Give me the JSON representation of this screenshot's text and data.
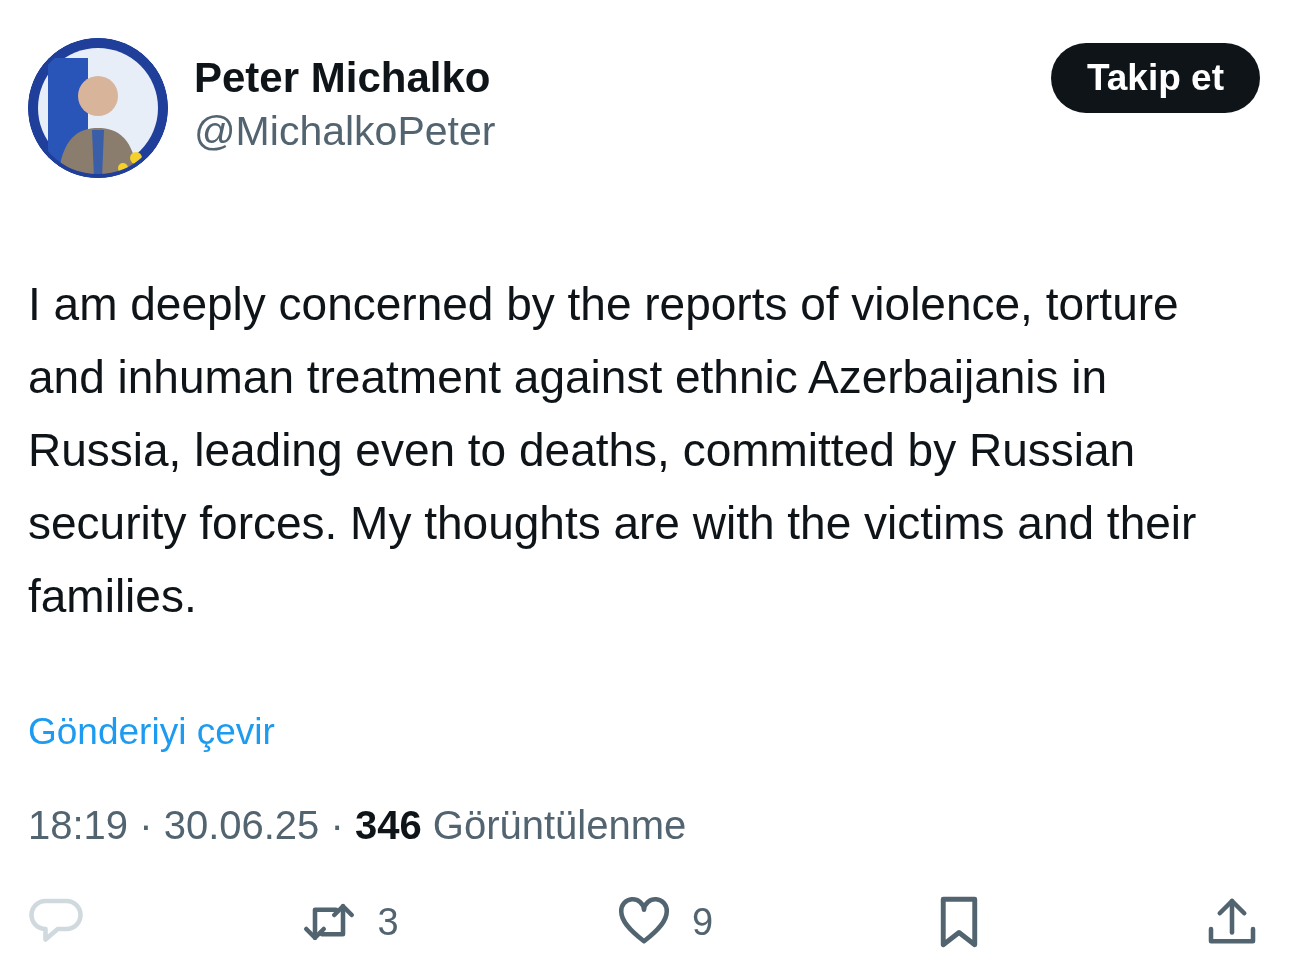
{
  "user": {
    "name": "Peter Michalko",
    "handle": "@MichalkoPeter"
  },
  "follow_button": {
    "label": "Takip et"
  },
  "text": "I am deeply concerned by the reports of violence, torture and inhuman treatment against ethnic Azerbaijanis in Russia, leading even to deaths, committed by Russian security forces. My thoughts are with the victims and their families.",
  "translate_link": "Gönderiyi çevir",
  "meta": "18:19 · 30.06.25 · **346** Görüntülenme",
  "actions": [
    {
      "kind": "reply"
    },
    {
      "kind": "retweet",
      "count": "3"
    },
    {
      "kind": "like",
      "count": "9"
    },
    {
      "kind": "bookmark"
    },
    {
      "kind": "share"
    }
  ]
}
